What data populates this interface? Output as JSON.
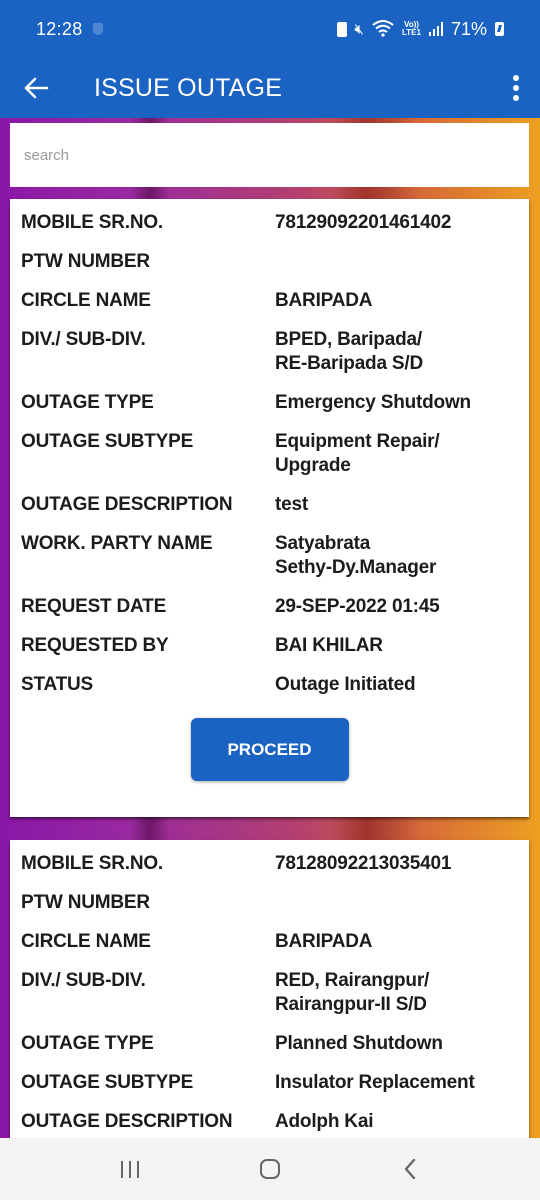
{
  "status_bar": {
    "time": "12:28",
    "battery_percent": "71%",
    "network_label_top": "Vo))",
    "network_label_bottom": "LTE1",
    "icons": [
      "shield-icon",
      "battery-saver-icon",
      "mute-icon",
      "wifi-icon",
      "lte-icon",
      "signal-icon",
      "battery-charging-icon"
    ]
  },
  "app_bar": {
    "title": "ISSUE OUTAGE",
    "back_icon": "arrow-left-icon",
    "menu_icon": "more-vertical-icon"
  },
  "search": {
    "placeholder": "search",
    "value": ""
  },
  "labels": {
    "mobile_sr_no": "MOBILE SR.NO.",
    "ptw_number": "PTW NUMBER",
    "circle_name": "CIRCLE NAME",
    "div_sub_div": "DIV./ SUB-DIV.",
    "outage_type": "OUTAGE TYPE",
    "outage_subtype": "OUTAGE SUBTYPE",
    "outage_description": "OUTAGE DESCRIPTION",
    "work_party_name": "WORK. PARTY NAME",
    "request_date": "REQUEST DATE",
    "requested_by": "REQUESTED BY",
    "status": "STATUS"
  },
  "outages": [
    {
      "mobile_sr_no": "78129092201461402",
      "ptw_number": "",
      "circle_name": "BARIPADA",
      "div_sub_div": "BPED, Baripada/\nRE-Baripada S/D",
      "outage_type": "Emergency Shutdown",
      "outage_subtype": "Equipment Repair/\nUpgrade",
      "outage_description": "test",
      "work_party_name": "Satyabrata\nSethy-Dy.Manager",
      "request_date": "29-SEP-2022 01:45",
      "requested_by": "BAI KHILAR",
      "status": "Outage Initiated",
      "action_label": "PROCEED"
    },
    {
      "mobile_sr_no": "78128092213035401",
      "ptw_number": "",
      "circle_name": "BARIPADA",
      "div_sub_div": "RED, Rairangpur/\nRairangpur-II S/D",
      "outage_type": "Planned Shutdown",
      "outage_subtype": "Insulator Replacement",
      "outage_description": "Adolph Kai"
    }
  ],
  "nav_bar": {
    "buttons": [
      "recents-icon",
      "home-icon",
      "back-icon"
    ]
  },
  "colors": {
    "primary": "#1a63c2",
    "text": "#1c1c1c",
    "placeholder": "#9a9a9a"
  }
}
